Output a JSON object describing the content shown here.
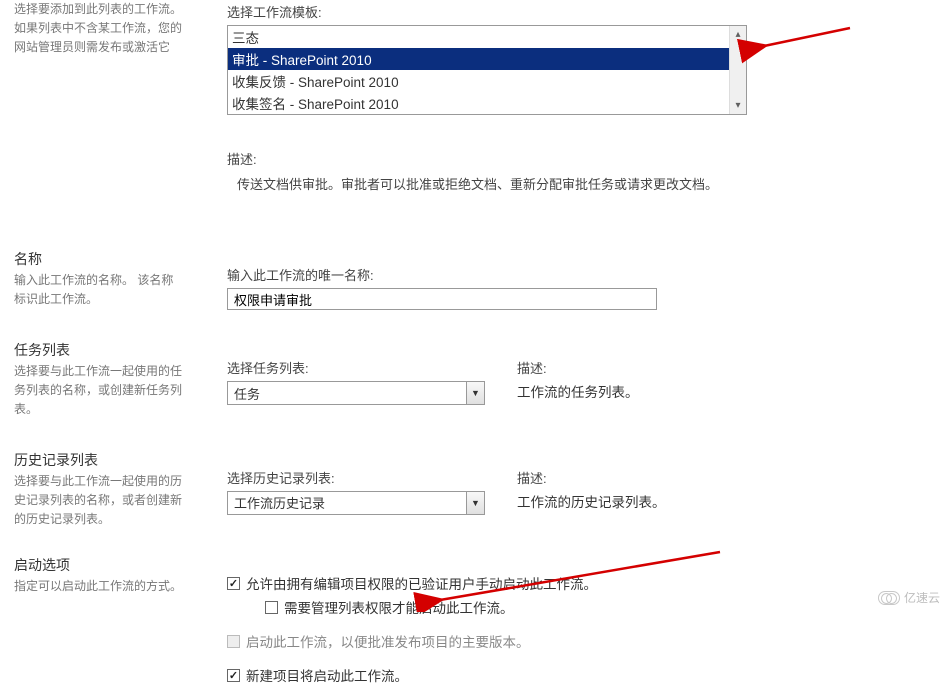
{
  "template_section": {
    "left_intro": "选择要添加到此列表的工作流。如果列表中不含某工作流，您的网站管理员则需发布或激活它",
    "field_label": "选择工作流模板:",
    "options": [
      "三态",
      "审批 - SharePoint 2010",
      "收集反馈 - SharePoint 2010",
      "收集签名 - SharePoint 2010"
    ],
    "selected_index": 1,
    "desc_label": "描述:",
    "desc_text": "传送文档供审批。审批者可以批准或拒绝文档、重新分配审批任务或请求更改文档。"
  },
  "name_section": {
    "title": "名称",
    "left_desc": "输入此工作流的名称。 该名称标识此工作流。",
    "field_label": "输入此工作流的唯一名称:",
    "value": "权限申请审批"
  },
  "task_section": {
    "title": "任务列表",
    "left_desc": "选择要与此工作流一起使用的任务列表的名称，或创建新任务列表。",
    "select_label": "选择任务列表:",
    "select_value": "任务",
    "desc_label": "描述:",
    "desc_text": "工作流的任务列表。"
  },
  "history_section": {
    "title": "历史记录列表",
    "left_desc": "选择要与此工作流一起使用的历史记录列表的名称，或者创建新的历史记录列表。",
    "select_label": "选择历史记录列表:",
    "select_value": "工作流历史记录",
    "desc_label": "描述:",
    "desc_text": "工作流的历史记录列表。"
  },
  "start_section": {
    "title": "启动选项",
    "left_desc": "指定可以启动此工作流的方式。",
    "opt1": "允许由拥有编辑项目权限的已验证用户手动启动此工作流。",
    "opt1_sub": "需要管理列表权限才能启动此工作流。",
    "opt2": "启动此工作流，以便批准发布项目的主要版本。",
    "opt3": "新建项目将启动此工作流。"
  },
  "watermark": "亿速云"
}
